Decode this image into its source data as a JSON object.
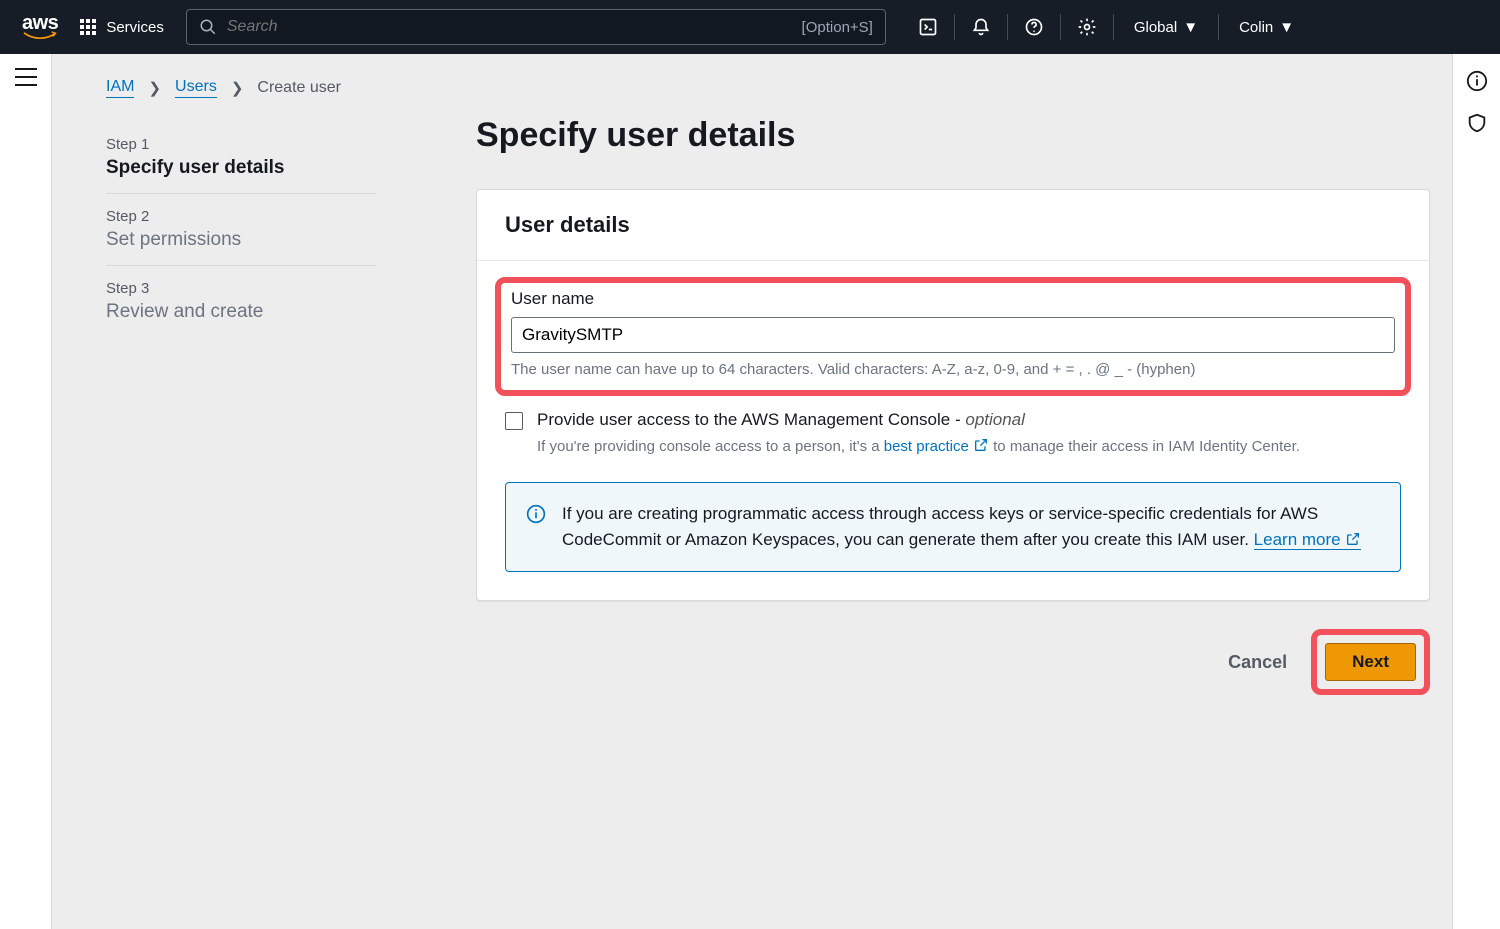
{
  "topnav": {
    "services_label": "Services",
    "search_placeholder": "Search",
    "shortcut": "[Option+S]",
    "region": "Global",
    "user": "Colin"
  },
  "breadcrumb": {
    "iam": "IAM",
    "users": "Users",
    "current": "Create user"
  },
  "steps": [
    {
      "label": "Step 1",
      "title": "Specify user details"
    },
    {
      "label": "Step 2",
      "title": "Set permissions"
    },
    {
      "label": "Step 3",
      "title": "Review and create"
    }
  ],
  "page": {
    "title": "Specify user details",
    "card_header": "User details",
    "username_label": "User name",
    "username_value": "GravitySMTP",
    "username_hint": "The user name can have up to 64 characters. Valid characters: A-Z, a-z, 0-9, and + = , . @ _ - (hyphen)",
    "console_access_label": "Provide user access to the AWS Management Console - ",
    "console_access_optional": "optional",
    "console_access_hint_pre": "If you're providing console access to a person, it's a ",
    "console_access_link": "best practice",
    "console_access_hint_post": " to manage their access in IAM Identity Center.",
    "info_text": "If you are creating programmatic access through access keys or service-specific credentials for AWS CodeCommit or Amazon Keyspaces, you can generate them after you create this IAM user. ",
    "info_link": "Learn more"
  },
  "actions": {
    "cancel": "Cancel",
    "next": "Next"
  }
}
